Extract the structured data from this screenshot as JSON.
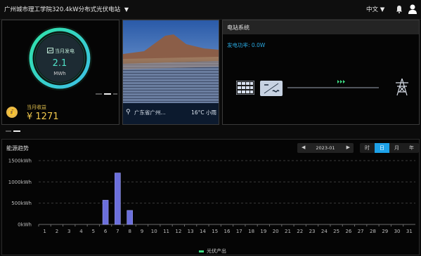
{
  "header": {
    "station_title": "广州城市理工学院320.4kW分布式光伏电站",
    "title_caret": "▼",
    "language": "中文 ▼"
  },
  "generation": {
    "label": "当月发电",
    "value": "2.1",
    "unit": "MWh",
    "income_label": "当月收益",
    "income_value": "¥ 1271",
    "coin_icon": "💰"
  },
  "site": {
    "location": "广东省广州...",
    "weather": "16°C  小雨"
  },
  "system": {
    "title": "电站系统",
    "power_label": "发电功率:",
    "power_value": "0.0W"
  },
  "trend": {
    "title": "能源趋势",
    "date": "2023-01",
    "prev": "◀",
    "next": "▶",
    "tabs": [
      "时",
      "日",
      "月",
      "年"
    ],
    "active_tab": "日",
    "legend": "光伏产出"
  },
  "chart_data": {
    "type": "bar",
    "categories": [
      "1",
      "2",
      "3",
      "4",
      "5",
      "6",
      "7",
      "8",
      "9",
      "10",
      "11",
      "12",
      "13",
      "14",
      "15",
      "16",
      "17",
      "18",
      "19",
      "20",
      "21",
      "22",
      "23",
      "24",
      "25",
      "26",
      "27",
      "28",
      "29",
      "30",
      "31"
    ],
    "series": [
      {
        "name": "光伏产出",
        "values": [
          0,
          0,
          0,
          0,
          0,
          570,
          1210,
          330,
          0,
          0,
          0,
          0,
          0,
          0,
          0,
          0,
          0,
          0,
          0,
          0,
          0,
          0,
          0,
          0,
          0,
          0,
          0,
          0,
          0,
          0,
          0
        ]
      }
    ],
    "y_ticks": [
      "0kWh",
      "500kWh",
      "1000kWh",
      "1500kWh"
    ],
    "ylim": [
      0,
      1500
    ],
    "grid": true,
    "legend_position": "bottom",
    "bar_color": "#6b6fdc"
  }
}
